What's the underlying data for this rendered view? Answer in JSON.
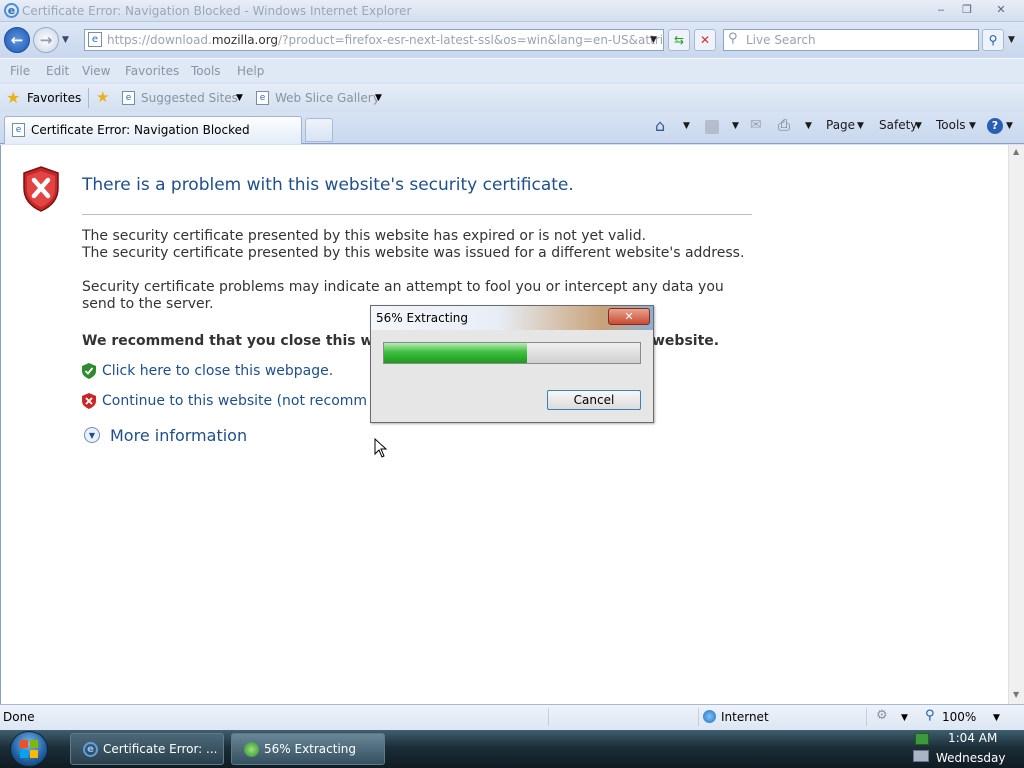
{
  "window": {
    "title": "Certificate Error: Navigation Blocked - Windows Internet Explorer",
    "minimize": "‒",
    "maximize": "❐",
    "close": "✕"
  },
  "address": {
    "url_prefix": "https://download.",
    "url_domain": "mozilla.org",
    "url_rest": "/?product=firefox-esr-next-latest-ssl&os=win&lang=en-US&attribution_",
    "search_placeholder": "Live Search"
  },
  "menu": [
    "File",
    "Edit",
    "View",
    "Favorites",
    "Tools",
    "Help"
  ],
  "favorites_bar": {
    "favorites": "Favorites",
    "suggested_sites": "Suggested Sites",
    "web_slice_gallery": "Web Slice Gallery"
  },
  "tab": {
    "title": "Certificate Error: Navigation Blocked"
  },
  "command_bar": {
    "page": "Page",
    "safety": "Safety",
    "tools": "Tools"
  },
  "page": {
    "heading": "There is a problem with this website's security certificate.",
    "line1": "The security certificate presented by this website has expired or is not yet valid.",
    "line2": "The security certificate presented by this website was issued for a different website's address.",
    "line3": "Security certificate problems may indicate an attempt to fool you or intercept any data you",
    "line4": "send to the server.",
    "recommend_start": "We recommend that you close this w",
    "recommend_end": "website.",
    "close_link": "Click here to close this webpage.",
    "continue_link": "Continue to this website (not recomm",
    "more_info": "More information"
  },
  "dialog": {
    "title": "56% Extracting",
    "progress": 0.56,
    "cancel": "Cancel"
  },
  "status": {
    "text": "Done",
    "zone": "Internet",
    "zoom": "100%"
  },
  "taskbar": {
    "task1": "Certificate Error: ...",
    "task2": "56% Extracting",
    "time": "1:04 AM",
    "day": "Wednesday"
  },
  "colors": {
    "link": "#1f4e8c",
    "progress_green": "#2fb52f",
    "error_red": "#c62828"
  }
}
